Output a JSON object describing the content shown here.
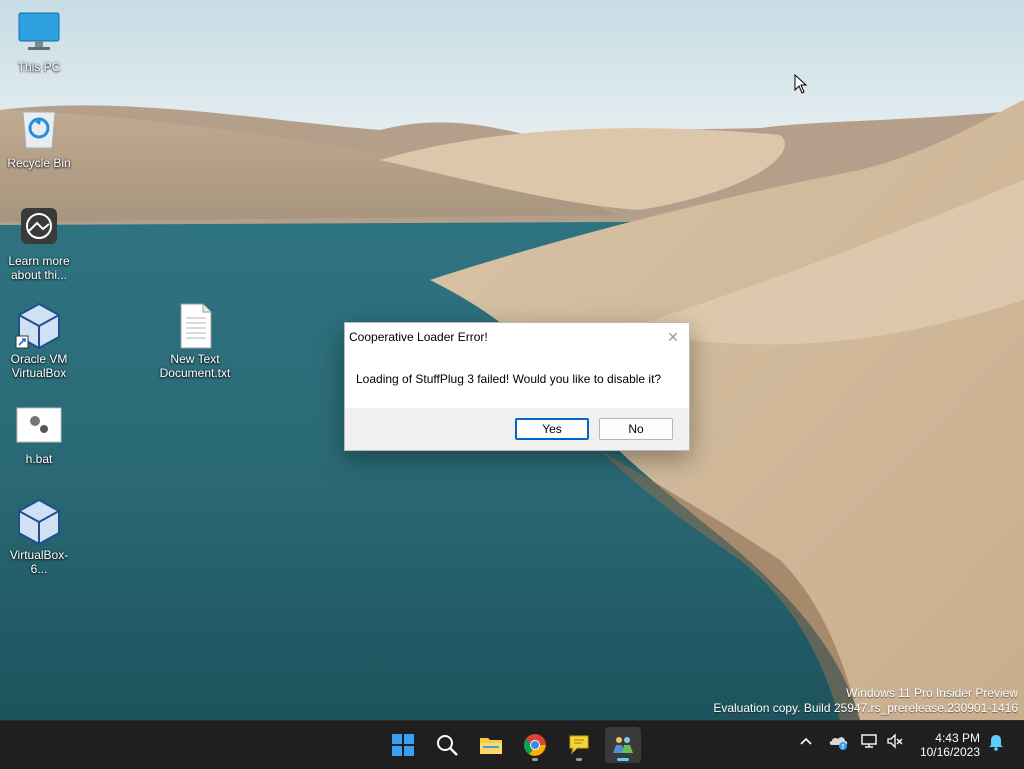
{
  "desktop_icons": [
    {
      "label": "This PC",
      "icon": "monitor-icon"
    },
    {
      "label": "Recycle Bin",
      "icon": "recycle-bin-icon"
    },
    {
      "label": "Learn more about thi...",
      "line1": "Learn more",
      "line2": "about thi...",
      "icon": "learn-more-icon"
    },
    {
      "label": "Oracle VM VirtualBox",
      "line1": "Oracle VM",
      "line2": "VirtualBox",
      "icon": "virtualbox-icon"
    },
    {
      "label": "h.bat",
      "icon": "batch-file-icon"
    },
    {
      "label": "VirtualBox-6...",
      "icon": "virtualbox-installer-icon"
    },
    {
      "label": "New Text Document.txt",
      "line1": "New Text",
      "line2": "Document.txt",
      "icon": "text-document-icon"
    }
  ],
  "dialog": {
    "title": "Cooperative Loader Error!",
    "close_glyph": "✕",
    "message": "Loading of StuffPlug 3 failed! Would you like to disable it?",
    "yes_label": "Yes",
    "no_label": "No"
  },
  "watermark": {
    "line1": "Windows 11 Pro Insider Preview",
    "line2": "Evaluation copy. Build 25947.rs_prerelease.230901-1416"
  },
  "taskbar": {
    "apps": [
      "start-icon",
      "search-icon",
      "file-explorer-icon",
      "chrome-icon",
      "chat-bubble-icon",
      "active-app-icon"
    ],
    "tray_icons": [
      "chevron-up-icon",
      "onedrive-icon",
      "network-icon",
      "volume-muted-icon",
      "notification-bell-icon"
    ],
    "time": "4:43 PM",
    "date": "10/16/2023"
  },
  "colors": {
    "accent": "#0067c0",
    "taskbar_bg": "#1f1f1f",
    "active_indicator": "#60cdff"
  }
}
